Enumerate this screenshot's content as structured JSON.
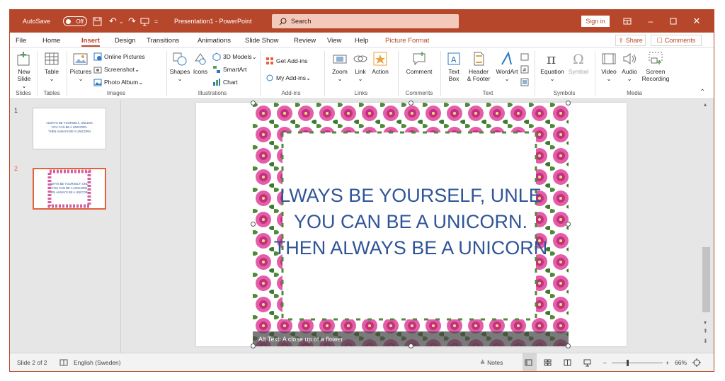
{
  "titlebar": {
    "autosave": "AutoSave",
    "toggle": "Off",
    "title": "Presentation1 - PowerPoint",
    "search": "Search",
    "signin": "Sign in"
  },
  "menu": {
    "file": "File",
    "home": "Home",
    "insert": "Insert",
    "design": "Design",
    "transitions": "Transitions",
    "animations": "Animations",
    "slideshow": "Slide Show",
    "review": "Review",
    "view": "View",
    "help": "Help",
    "picture_format": "Picture Format",
    "share": "Share",
    "comments": "Comments"
  },
  "ribbon": {
    "new_slide": "New",
    "new_slide2": "Slide",
    "table": "Table",
    "pictures": "Pictures",
    "online_pictures": "Online Pictures",
    "screenshot": "Screenshot",
    "photo_album": "Photo Album",
    "shapes": "Shapes",
    "icons": "Icons",
    "models3d": "3D Models",
    "smartart": "SmartArt",
    "chart": "Chart",
    "get_addins": "Get Add-ins",
    "my_addins": "My Add-ins",
    "zoom": "Zoom",
    "link": "Link",
    "action": "Action",
    "comment": "Comment",
    "text_box": "Text",
    "text_box2": "Box",
    "header_footer": "Header",
    "header_footer2": "& Footer",
    "wordart": "WordArt",
    "equation": "Equation",
    "symbol": "Symbol",
    "video": "Video",
    "audio": "Audio",
    "screen_recording": "Screen",
    "screen_recording2": "Recording",
    "groups": {
      "slides": "Slides",
      "tables": "Tables",
      "images": "Images",
      "illustrations": "Illustrations",
      "addins": "Add-ins",
      "links": "Links",
      "comments": "Comments",
      "text": "Text",
      "symbols": "Symbols",
      "media": "Media"
    }
  },
  "thumbs": [
    {
      "num": "1",
      "l1": "ALWAYS BE YOURSELF, UNLESS",
      "l2": "YOU CAN BE A UNICORN.",
      "l3": "THEN ALWAYS BE A UNICORN"
    },
    {
      "num": "2",
      "l1": "WAYS BE YOURSELF, UNL",
      "l2": "YOU CAN BE A UNICORN",
      "l3": "EN ALWAYS BE A UNICOR"
    }
  ],
  "slide": {
    "line1": "LWAYS BE YOURSELF, UNLE",
    "line2": "YOU CAN BE A UNICORN.",
    "line3": "THEN ALWAYS BE A UNICORN",
    "alt": "Alt Text: A close up of a flower"
  },
  "status": {
    "slide": "Slide 2 of 2",
    "language": "English (Sweden)",
    "notes": "Notes",
    "zoom": "66%"
  },
  "colors": {
    "accent": "#b7472a",
    "text": "#2f5597"
  }
}
